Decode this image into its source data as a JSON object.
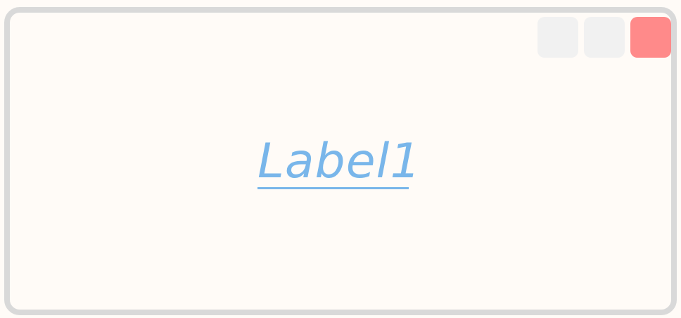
{
  "window": {
    "title": "",
    "controls": {
      "minimize_icon": "minimize-icon",
      "maximize_icon": "maximize-icon",
      "close_icon": "close-icon",
      "close_color": "#ff8a8a",
      "button_color": "#f1f1f1"
    }
  },
  "main": {
    "link_label": "Label1",
    "link_color": "#79b6ea"
  },
  "colors": {
    "background": "#fffbf7",
    "border": "#d9d9d9"
  }
}
